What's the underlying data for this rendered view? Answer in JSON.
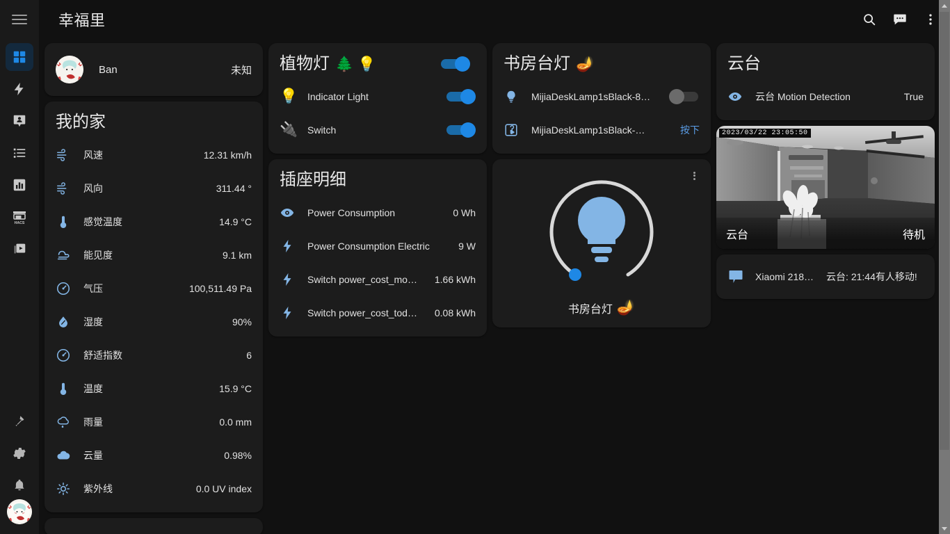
{
  "header": {
    "title": "幸福里",
    "menu_icon": "hamburger-icon",
    "search_label": "search-icon",
    "assist_label": "assist-icon",
    "overflow_label": "overflow-menu-icon"
  },
  "sidebar": {
    "items": [
      {
        "icon": "dashboard-grid-icon",
        "name": "overview",
        "active": true
      },
      {
        "icon": "lightning-bolt-icon",
        "name": "energy",
        "active": false
      },
      {
        "icon": "person-pin-icon",
        "name": "map",
        "active": false
      },
      {
        "icon": "list-icon",
        "name": "logbook",
        "active": false
      },
      {
        "icon": "bar-chart-icon",
        "name": "history",
        "active": false
      },
      {
        "icon": "hacs-icon",
        "name": "hacs",
        "active": false
      },
      {
        "icon": "media-play-icon",
        "name": "media",
        "active": false
      }
    ],
    "bottom_items": [
      {
        "icon": "hammer-icon",
        "name": "developer-tools"
      },
      {
        "icon": "gear-icon",
        "name": "settings"
      },
      {
        "icon": "bell-icon",
        "name": "notifications"
      }
    ],
    "avatar_label": "user-avatar"
  },
  "person_card": {
    "name": "Ban",
    "state": "未知"
  },
  "home_card": {
    "title": "我的家",
    "rows": [
      {
        "icon": "wind-icon",
        "name": "风速",
        "value": "12.31 km/h"
      },
      {
        "icon": "wind-icon",
        "name": "风向",
        "value": "311.44 °"
      },
      {
        "icon": "thermometer-icon",
        "name": "感觉温度",
        "value": "14.9 °C"
      },
      {
        "icon": "visibility-icon",
        "name": "能见度",
        "value": "9.1 km"
      },
      {
        "icon": "gauge-icon",
        "name": "气压",
        "value": "100,511.49 Pa"
      },
      {
        "icon": "humidity-icon",
        "name": "湿度",
        "value": "90%"
      },
      {
        "icon": "gauge-icon",
        "name": "舒适指数",
        "value": "6"
      },
      {
        "icon": "thermometer-icon",
        "name": "温度",
        "value": "15.9 °C"
      },
      {
        "icon": "rainy-icon",
        "name": "雨量",
        "value": "0.0 mm"
      },
      {
        "icon": "cloud-icon",
        "name": "云量",
        "value": "0.98%"
      },
      {
        "icon": "uv-sun-icon",
        "name": "紫外线",
        "value": "0.0 UV index"
      }
    ]
  },
  "plant_light_card": {
    "title": "植物灯",
    "title_emoji": "🌲 💡",
    "header_toggle": "on",
    "rows": [
      {
        "icon": "bulb-emoji",
        "emoji": "💡",
        "name": "Indicator Light",
        "toggle": "on"
      },
      {
        "icon": "plug-emoji",
        "emoji": "🔌",
        "name": "Switch",
        "toggle": "on"
      }
    ]
  },
  "socket_card": {
    "title": "插座明细",
    "rows": [
      {
        "icon": "eye-icon",
        "name": "Power Consumption",
        "value": "0 Wh"
      },
      {
        "icon": "bolt-flat-icon",
        "name": "Power Consumption Electric",
        "value": "9 W"
      },
      {
        "icon": "bolt-icon",
        "name": "Switch power_cost_mo…",
        "value": "1.66 kWh"
      },
      {
        "icon": "bolt-icon",
        "name": "Switch power_cost_tod…",
        "value": "0.08 kWh"
      }
    ]
  },
  "desk_lamp_card": {
    "title": "书房台灯",
    "title_emoji": "🪔",
    "rows": [
      {
        "icon": "bulb-icon",
        "name": "MijiaDeskLamp1sBlack-8…",
        "toggle": "off",
        "value": ""
      },
      {
        "icon": "button-icon",
        "name": "MijiaDeskLamp1sBlack-…",
        "toggle": "none",
        "value": "按下"
      }
    ]
  },
  "light_slider_card": {
    "name": "书房台灯",
    "emoji": "🪔",
    "state": "on",
    "brightness_percent": 0,
    "more_info_label": "more-options"
  },
  "camera_card": {
    "timestamp": "2023/03/22  23:05:50",
    "name": "云台",
    "state": "待机"
  },
  "ptz_card": {
    "title": "云台",
    "rows": [
      {
        "icon": "eye-icon",
        "name": "云台 Motion Detection",
        "value": "True"
      }
    ]
  },
  "notification_card": {
    "icon": "message-icon",
    "source": "Xiaomi 218…",
    "message": "云台: 21:44有人移动!"
  },
  "colors": {
    "page_bg": "#111111",
    "card_bg": "#1c1c1c",
    "accent": "#1e88e5",
    "text_primary": "#e1e1e1",
    "icon_blue": "#83b5e5",
    "sidebar_bg": "#1a1a1a",
    "sidebar_active_bg": "#13293d"
  }
}
